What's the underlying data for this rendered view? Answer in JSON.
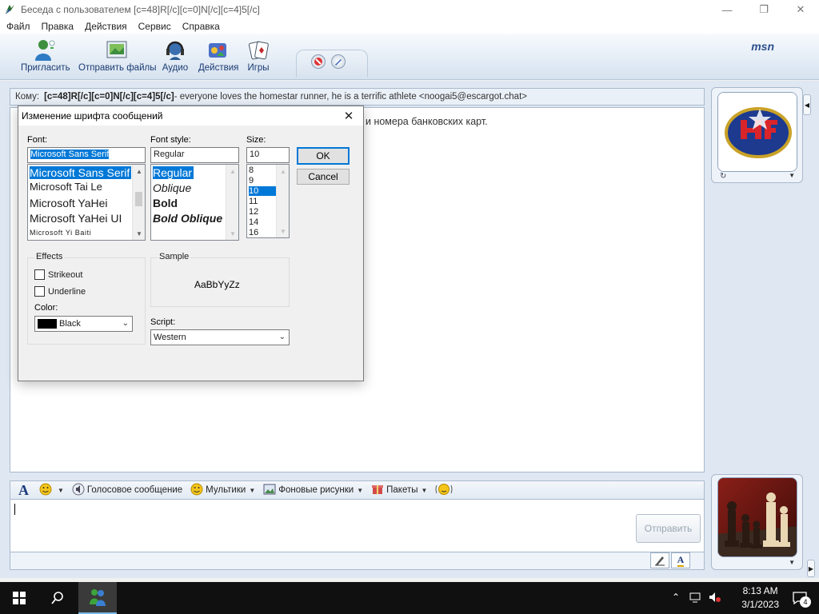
{
  "window": {
    "title": "Беседа с пользователем [c=48]R[/c][c=0]N[/c][c=4]5[/c]",
    "controls": {
      "minimize": "—",
      "maximize": "❐",
      "close": "✕"
    }
  },
  "menu": [
    "Файл",
    "Правка",
    "Действия",
    "Сервис",
    "Справка"
  ],
  "toolbar": {
    "buttons": [
      {
        "label": "Пригласить",
        "icon": "invite-contacts-icon"
      },
      {
        "label": "Отправить файлы",
        "icon": "send-files-icon"
      },
      {
        "label": "Аудио",
        "icon": "audio-headset-icon"
      },
      {
        "label": "Действия",
        "icon": "activities-icon"
      },
      {
        "label": "Игры",
        "icon": "games-cards-icon"
      }
    ],
    "logo": "msn"
  },
  "conversation": {
    "to_label": "Кому:",
    "to_name": "[c=48]R[/c][c=0]N[/c][c=4]5[/c]",
    "to_rest": " - everyone loves the homestar runner, he is a terrific athlete <noogai5@escargot.chat>",
    "history_visible_text": "и номера банковских карт."
  },
  "format_bar": {
    "items": [
      {
        "label": "",
        "icon": "font-a-icon"
      },
      {
        "label": "",
        "icon": "emoticon-icon",
        "dropdown": true
      },
      {
        "label": "Голосовое сообщение",
        "icon": "voice-clip-icon"
      },
      {
        "label": "Мультики",
        "icon": "winks-icon",
        "dropdown": true
      },
      {
        "label": "Фоновые рисунки",
        "icon": "backgrounds-icon",
        "dropdown": true
      },
      {
        "label": "Пакеты",
        "icon": "packs-icon",
        "dropdown": true
      },
      {
        "label": "",
        "icon": "nudge-icon"
      }
    ]
  },
  "send_button": "Отправить",
  "dialog": {
    "title": "Изменение шрифта сообщений",
    "font_label": "Font:",
    "font_value": "Microsoft Sans Serif",
    "font_list": [
      "Microsoft Sans Serif",
      "Microsoft Tai Le",
      "Microsoft YaHei",
      "Microsoft YaHei UI",
      "Microsoft Yi Baiti"
    ],
    "font_selected_index": 0,
    "style_label": "Font style:",
    "style_value": "Regular",
    "style_list": [
      "Regular",
      "Oblique",
      "Bold",
      "Bold Oblique"
    ],
    "style_selected_index": 0,
    "size_label": "Size:",
    "size_value": "10",
    "size_list": [
      "8",
      "9",
      "10",
      "11",
      "12",
      "14",
      "16"
    ],
    "size_selected_index": 2,
    "ok": "OK",
    "cancel": "Cancel",
    "effects_label": "Effects",
    "strikeout": "Strikeout",
    "underline": "Underline",
    "strikeout_checked": false,
    "underline_checked": false,
    "color_label": "Color:",
    "color_value": "Black",
    "color_hex": "#000000",
    "sample_label": "Sample",
    "sample_text": "AaBbYyZz",
    "script_label": "Script:",
    "script_value": "Western"
  },
  "taskbar": {
    "time": "8:13 AM",
    "date": "3/1/2023",
    "notification_count": "4"
  },
  "colors": {
    "accent": "#0078d7",
    "toolbar_label": "#1b3b72",
    "frame": "#dfe8f2"
  }
}
